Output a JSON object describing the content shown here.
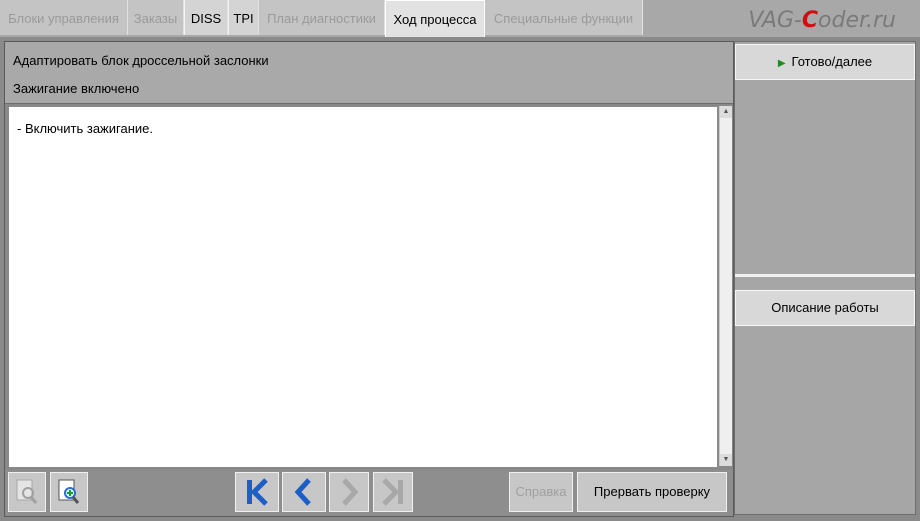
{
  "tabs": [
    {
      "label": "Блоки управления"
    },
    {
      "label": "Заказы"
    },
    {
      "label": "DISS"
    },
    {
      "label": "TPI"
    },
    {
      "label": "План диагностики"
    },
    {
      "label": "Ход процесса"
    },
    {
      "label": "Специальные функции"
    }
  ],
  "brand": {
    "pre": "VAG-",
    "c": "C",
    "post": "oder.ru"
  },
  "header": {
    "title": "Адаптировать блок дроссельной заслонки",
    "subtitle": "Зажигание включено"
  },
  "content": {
    "text": "- Включить зажигание."
  },
  "side": {
    "next": "Готово/далее",
    "desc": "Описание работы"
  },
  "toolbar": {
    "help": "Справка",
    "abort": "Прервать проверку"
  }
}
